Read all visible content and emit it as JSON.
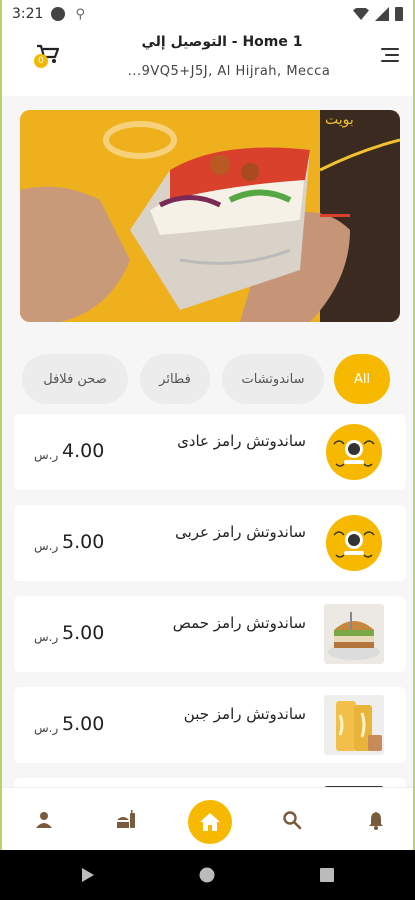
{
  "status_bar": {
    "time": "3:21"
  },
  "header": {
    "delivery_title": "التوصيل إلي - Home 1",
    "address": "...9VQ5+J5J, Al Hijrah, Mecca",
    "cart_count": "0"
  },
  "categories": [
    {
      "label": "All",
      "active": true
    },
    {
      "label": "ساندوتشات",
      "active": false
    },
    {
      "label": "فطائر",
      "active": false
    },
    {
      "label": "صحن فلافل",
      "active": false
    }
  ],
  "products": [
    {
      "name": "ساندوتش رامز عادى",
      "price": "4.00",
      "currency": "ر.س",
      "image": "ramez-logo"
    },
    {
      "name": "ساندوتش رامز عربى",
      "price": "5.00",
      "currency": "ر.س",
      "image": "ramez-logo"
    },
    {
      "name": "ساندوتش رامز حمص",
      "price": "5.00",
      "currency": "ر.س",
      "image": "hummus-sandwich-photo"
    },
    {
      "name": "ساندوتش رامز جبن",
      "price": "5.00",
      "currency": "ر.س",
      "image": "cheese-sandwich-photo"
    }
  ],
  "bottom_nav": [
    {
      "icon": "profile-icon"
    },
    {
      "icon": "menu-food-icon"
    },
    {
      "icon": "home-icon",
      "active": true
    },
    {
      "icon": "search-icon"
    },
    {
      "icon": "bell-icon"
    }
  ],
  "colors": {
    "accent": "#f6b900",
    "chip_bg": "#ececec"
  }
}
